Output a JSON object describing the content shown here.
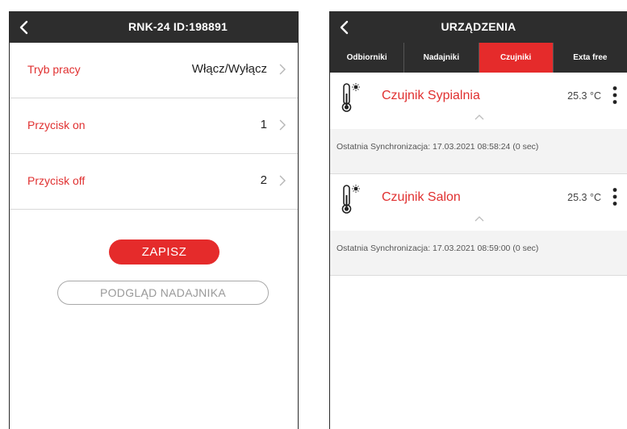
{
  "left": {
    "title": "RNK-24 ID:198891",
    "rows": [
      {
        "label": "Tryb pracy",
        "value": "Włącz/Wyłącz"
      },
      {
        "label": "Przycisk on",
        "value": "1"
      },
      {
        "label": "Przycisk off",
        "value": "2"
      }
    ],
    "save_label": "ZAPISZ",
    "preview_label": "PODGLĄD NADAJNIKA"
  },
  "right": {
    "title": "URZĄDZENIA",
    "tabs": [
      {
        "label": "Odbiorniki"
      },
      {
        "label": "Nadajniki"
      },
      {
        "label": "Czujniki"
      },
      {
        "label": "Exta free"
      }
    ],
    "active_tab": "Czujniki",
    "sensors": [
      {
        "name": "Czujnik Sypialnia",
        "temp": "25.3 °C",
        "sync": "Ostatnia Synchronizacja: 17.03.2021 08:58:24 (0 sec)"
      },
      {
        "name": "Czujnik Salon",
        "temp": "25.3 °C",
        "sync": "Ostatnia Synchronizacja: 17.03.2021 08:59:00 (0 sec)"
      }
    ]
  },
  "icons": {
    "back": "chevron-left-icon",
    "row": "chevron-right-icon",
    "sensor": "thermometer-icon",
    "menu": "more-vertical-icon",
    "collapse": "chevron-up-icon"
  },
  "colors": {
    "header": "#2d2d2d",
    "accent": "#e52b2b",
    "sync_bg": "#f3f3f3"
  }
}
